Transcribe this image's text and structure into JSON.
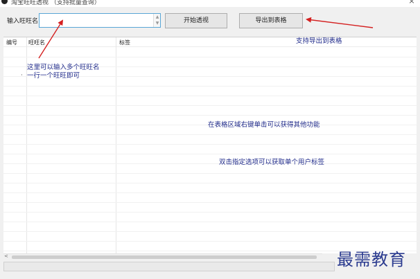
{
  "window": {
    "title": "淘宝旺旺透视  （支持批量查询）",
    "close_glyph": "×"
  },
  "toolbar": {
    "input_label": "输入旺旺名:",
    "input_value": "",
    "scroll_up": "▲",
    "scroll_down": "▼",
    "start_button": "开始透视",
    "export_button": "导出到表格"
  },
  "grid": {
    "columns": [
      "编号",
      "旺旺名",
      "标签"
    ]
  },
  "hscroll": {
    "left_glyph": "<"
  },
  "annotations": {
    "export_tip": "支持导出到表格",
    "input_tip_line1": "这里可以输入多个旺旺名",
    "input_tip_line2": "一行一个旺旺即可",
    "bullet": "·",
    "right_click_tip": "在表格区域右键单击可以获得其他功能",
    "double_click_tip": "双击指定选项可以获取单个用户标签"
  },
  "watermark": "最需教育",
  "colors": {
    "annotation_text": "#1f2a8a",
    "arrow": "#d42020",
    "input_border": "#58a6d6"
  }
}
